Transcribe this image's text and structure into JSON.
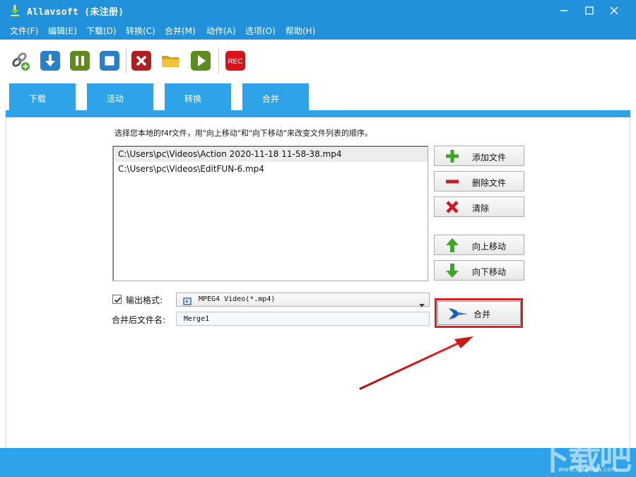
{
  "window": {
    "title": "Allavsoft (未注册)",
    "minimize_symbol": "minimize-icon",
    "maximize_symbol": "maximize-icon",
    "close_symbol": "close-icon"
  },
  "menu": [
    {
      "label": "文件(F)"
    },
    {
      "label": "编辑(E)"
    },
    {
      "label": "下载(D)"
    },
    {
      "label": "转换(C)"
    },
    {
      "label": "合并(M)"
    },
    {
      "label": "动作(A)"
    },
    {
      "label": "选项(O)"
    },
    {
      "label": "帮助(H)"
    }
  ],
  "toolbar": {
    "rec_label": "REC"
  },
  "tabs": [
    {
      "label": "下载"
    },
    {
      "label": "活动"
    },
    {
      "label": "转换"
    },
    {
      "label": "合并",
      "active": true
    }
  ],
  "merge_panel": {
    "instruction": "选择您本地的f4f文件，用\"向上移动\"和\"向下移动\"来改变文件列表的顺序。",
    "files": [
      "C:\\Users\\pc\\Videos\\Action 2020-11-18 11-58-38.mp4",
      "C:\\Users\\pc\\Videos\\EditFUN-6.mp4"
    ],
    "buttons": {
      "add_file": "添加文件",
      "delete_file": "删除文件",
      "clear": "清除",
      "move_up": "向上移动",
      "move_down": "向下移动",
      "merge": "合并"
    },
    "output_format_label": "输出格式:",
    "output_format_checked": true,
    "output_format_value": "MPEG4 Video(*.mp4)",
    "merged_name_label": "合并后文件名:",
    "merged_name_value": "Merge1"
  },
  "watermark": {
    "text": "下载吧",
    "url": "www.xiazaiba.com"
  },
  "colors": {
    "titlebar": "#2291dc",
    "tab": "#2fa3e9",
    "highlight": "#e02020"
  }
}
